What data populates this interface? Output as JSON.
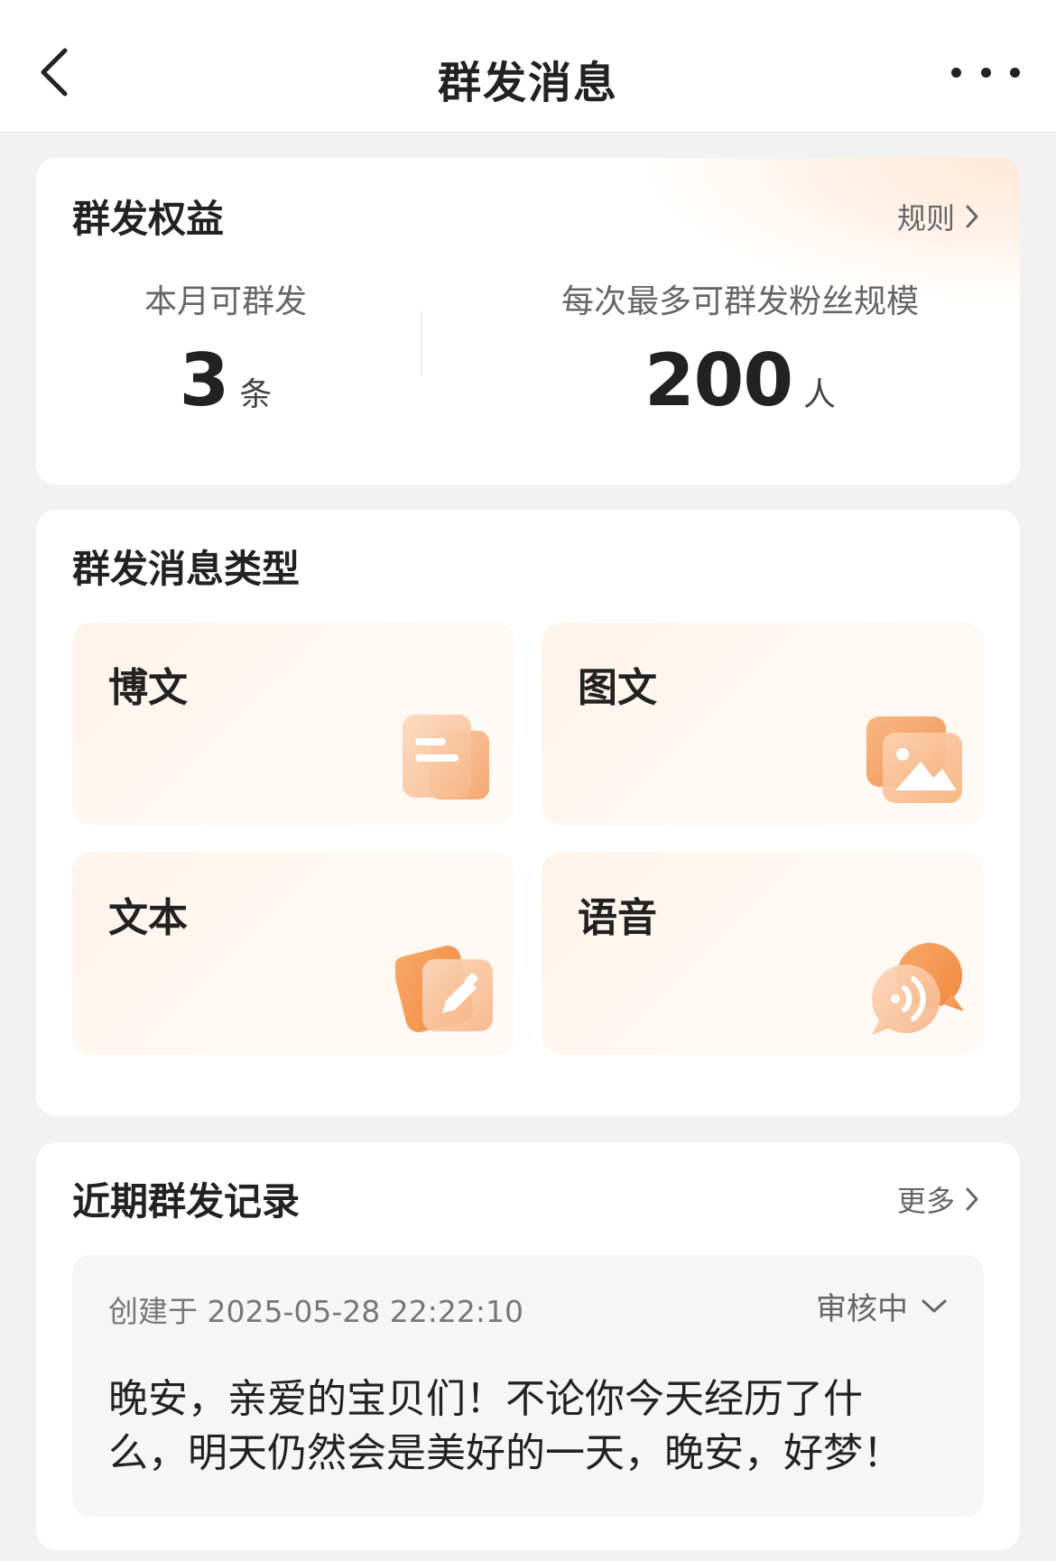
{
  "nav": {
    "title": "群发消息"
  },
  "rights": {
    "title": "群发权益",
    "rules_link": "规则",
    "monthly": {
      "label": "本月可群发",
      "value": "3",
      "unit": "条"
    },
    "scale": {
      "label": "每次最多可群发粉丝规模",
      "value": "200",
      "unit": "人"
    }
  },
  "types": {
    "title": "群发消息类型",
    "items": [
      {
        "label": "博文",
        "icon": "article-icon"
      },
      {
        "label": "图文",
        "icon": "image-icon"
      },
      {
        "label": "文本",
        "icon": "edit-icon"
      },
      {
        "label": "语音",
        "icon": "voice-icon"
      }
    ]
  },
  "records": {
    "title": "近期群发记录",
    "more_link": "更多",
    "items": [
      {
        "created": "创建于 2025-05-28 22:22:10",
        "status": "审核中",
        "text": "晚安，亲爱的宝贝们！不论你今天经历了什么，明天仍然会是美好的一天，晚安，好梦！"
      }
    ]
  },
  "colors": {
    "accent": "#f5a066",
    "tile_bg": "#fff5ec",
    "page_bg": "#f2f2f2"
  }
}
